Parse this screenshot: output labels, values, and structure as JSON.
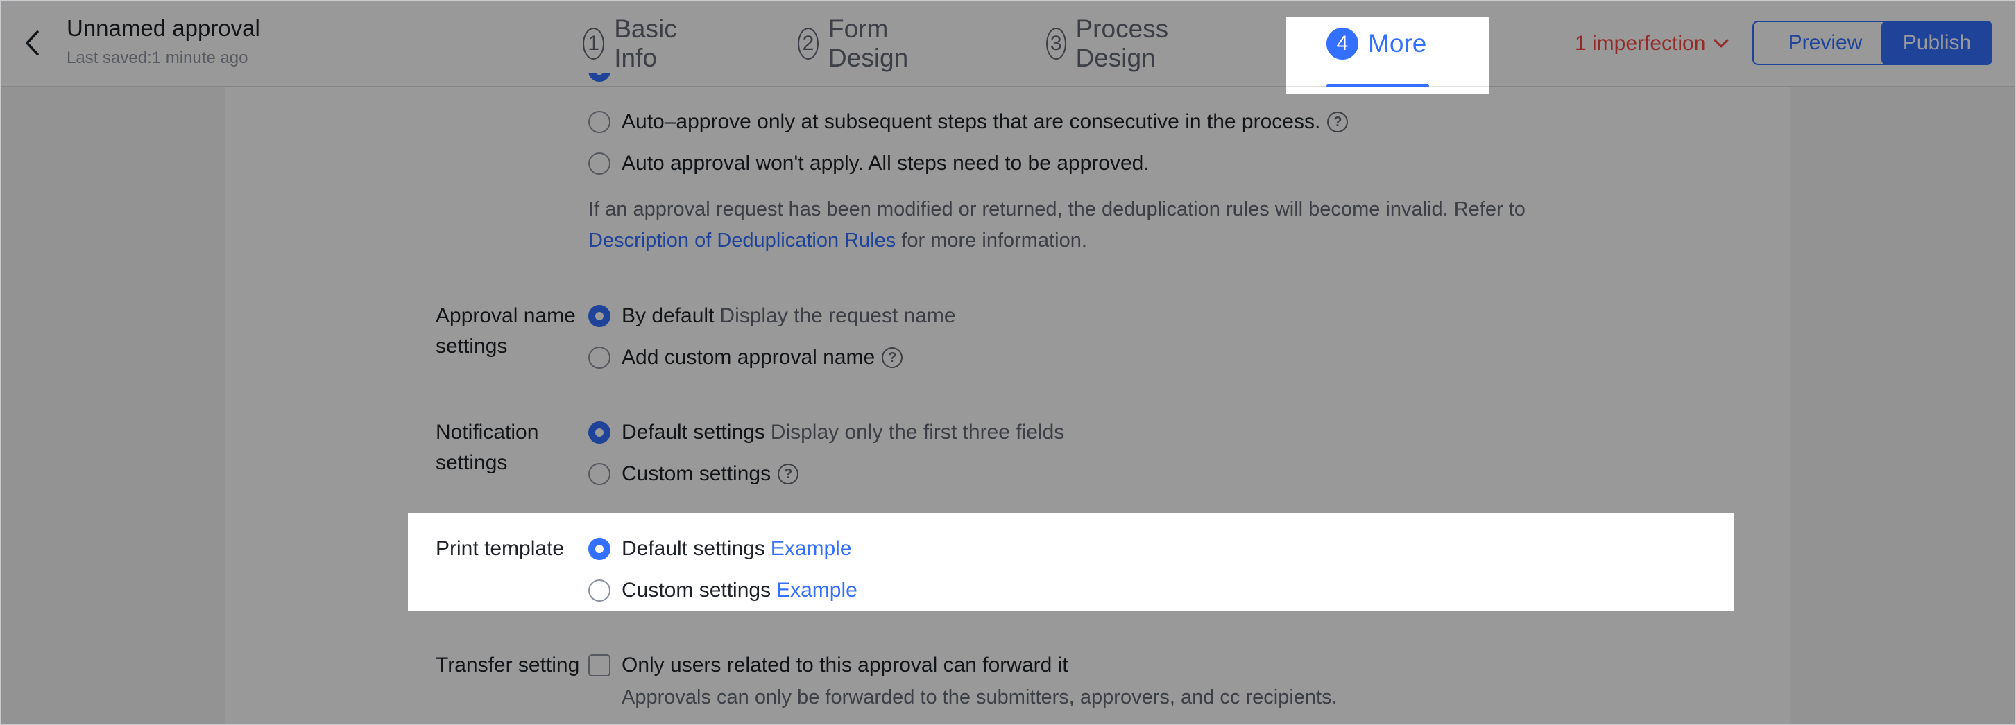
{
  "header": {
    "title": "Unnamed approval",
    "last_saved": "Last saved:1 minute ago",
    "steps": [
      {
        "num": "1",
        "label": "Basic Info",
        "active": false
      },
      {
        "num": "2",
        "label": "Form Design",
        "active": false
      },
      {
        "num": "3",
        "label": "Process Design",
        "active": false
      },
      {
        "num": "4",
        "label": "More",
        "active": true
      }
    ],
    "imperfection": "1 imperfection",
    "preview_label": "Preview",
    "publish_label": "Publish"
  },
  "deduplication": {
    "options": [
      {
        "label": "Auto–approve only at subsequent steps that are consecutive in the process.",
        "checked": false,
        "help": true
      },
      {
        "label": "Auto approval won't apply. All steps need to be approved.",
        "checked": false,
        "help": false
      }
    ],
    "info_prefix": "If an approval request has been modified or returned, the deduplication rules will become invalid. Refer to",
    "info_link": "Description of Deduplication Rules",
    "info_suffix": "for more information."
  },
  "approval_name": {
    "label": "Approval name settings",
    "options": [
      {
        "label": "By default",
        "desc": "Display the request name",
        "checked": true
      },
      {
        "label": "Add custom approval name",
        "checked": false,
        "help": true
      }
    ]
  },
  "notification": {
    "label": "Notification settings",
    "options": [
      {
        "label": "Default settings",
        "desc": "Display only the first three fields",
        "checked": true
      },
      {
        "label": "Custom settings",
        "checked": false,
        "help": true
      }
    ]
  },
  "print_template": {
    "label": "Print template",
    "options": [
      {
        "label": "Default settings",
        "link": "Example",
        "checked": true
      },
      {
        "label": "Custom settings",
        "link": "Example",
        "checked": false
      }
    ]
  },
  "transfer": {
    "label": "Transfer setting",
    "checkbox_label": "Only users related to this approval can forward it",
    "checked": false,
    "note": "Approvals can only be forwarded to the submitters, approvers, and cc recipients."
  },
  "colors": {
    "accent": "#3370ff",
    "warning": "#f54a45",
    "text": "#1f2329",
    "muted": "#646a73",
    "overlay": "rgba(0,0,0,0.40)"
  },
  "icons": {
    "back": "chevron-left-icon",
    "imperfection": "chevron-down-icon",
    "help": "question-circle-icon"
  }
}
